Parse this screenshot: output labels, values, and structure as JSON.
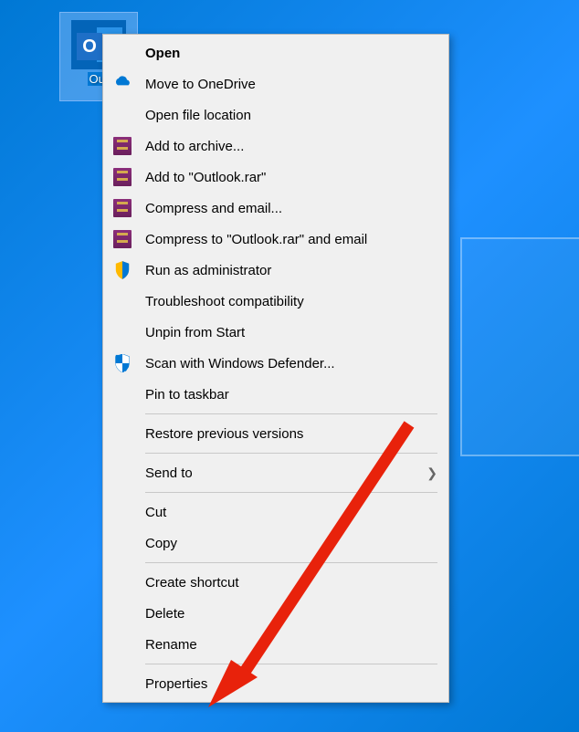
{
  "desktop": {
    "icon_label": "Out",
    "icon_letter": "O"
  },
  "menu": {
    "items": [
      {
        "label": "Open",
        "icon": "none",
        "bold": true
      },
      {
        "label": "Move to OneDrive",
        "icon": "onedrive"
      },
      {
        "label": "Open file location",
        "icon": "none"
      },
      {
        "label": "Add to archive...",
        "icon": "winrar"
      },
      {
        "label": "Add to \"Outlook.rar\"",
        "icon": "winrar"
      },
      {
        "label": "Compress and email...",
        "icon": "winrar"
      },
      {
        "label": "Compress to \"Outlook.rar\" and email",
        "icon": "winrar"
      },
      {
        "label": "Run as administrator",
        "icon": "shield-admin"
      },
      {
        "label": "Troubleshoot compatibility",
        "icon": "none"
      },
      {
        "label": "Unpin from Start",
        "icon": "none"
      },
      {
        "label": "Scan with Windows Defender...",
        "icon": "defender"
      },
      {
        "label": "Pin to taskbar",
        "icon": "none"
      },
      {
        "separator": true
      },
      {
        "label": "Restore previous versions",
        "icon": "none"
      },
      {
        "separator": true
      },
      {
        "label": "Send to",
        "icon": "none",
        "submenu": true
      },
      {
        "separator": true
      },
      {
        "label": "Cut",
        "icon": "none"
      },
      {
        "label": "Copy",
        "icon": "none"
      },
      {
        "separator": true
      },
      {
        "label": "Create shortcut",
        "icon": "none"
      },
      {
        "label": "Delete",
        "icon": "none"
      },
      {
        "label": "Rename",
        "icon": "none"
      },
      {
        "separator": true
      },
      {
        "label": "Properties",
        "icon": "none"
      }
    ]
  }
}
